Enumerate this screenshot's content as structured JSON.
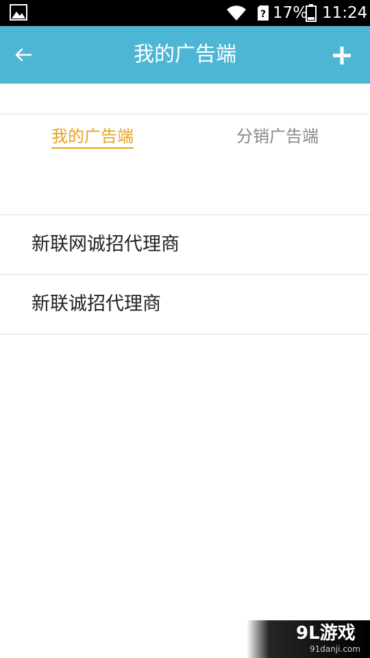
{
  "status_bar": {
    "battery_percent": "17%",
    "time": "11:24",
    "icons": [
      "gallery-icon",
      "wifi-icon",
      "sim-unknown-icon",
      "battery-icon"
    ]
  },
  "header": {
    "title": "我的广告端",
    "back_icon": "arrow-left-icon",
    "add_icon": "plus-icon",
    "background_color": "#4db6d4"
  },
  "tabs": [
    {
      "label": "我的广告端",
      "active": true
    },
    {
      "label": "分销广告端",
      "active": false
    }
  ],
  "accent_color": "#e6a21c",
  "list": {
    "items": [
      {
        "label": "新联网诚招代理商"
      },
      {
        "label": "新联诚招代理商"
      }
    ]
  },
  "watermark": {
    "logo": "9L游戏",
    "url": "91danji.com"
  }
}
